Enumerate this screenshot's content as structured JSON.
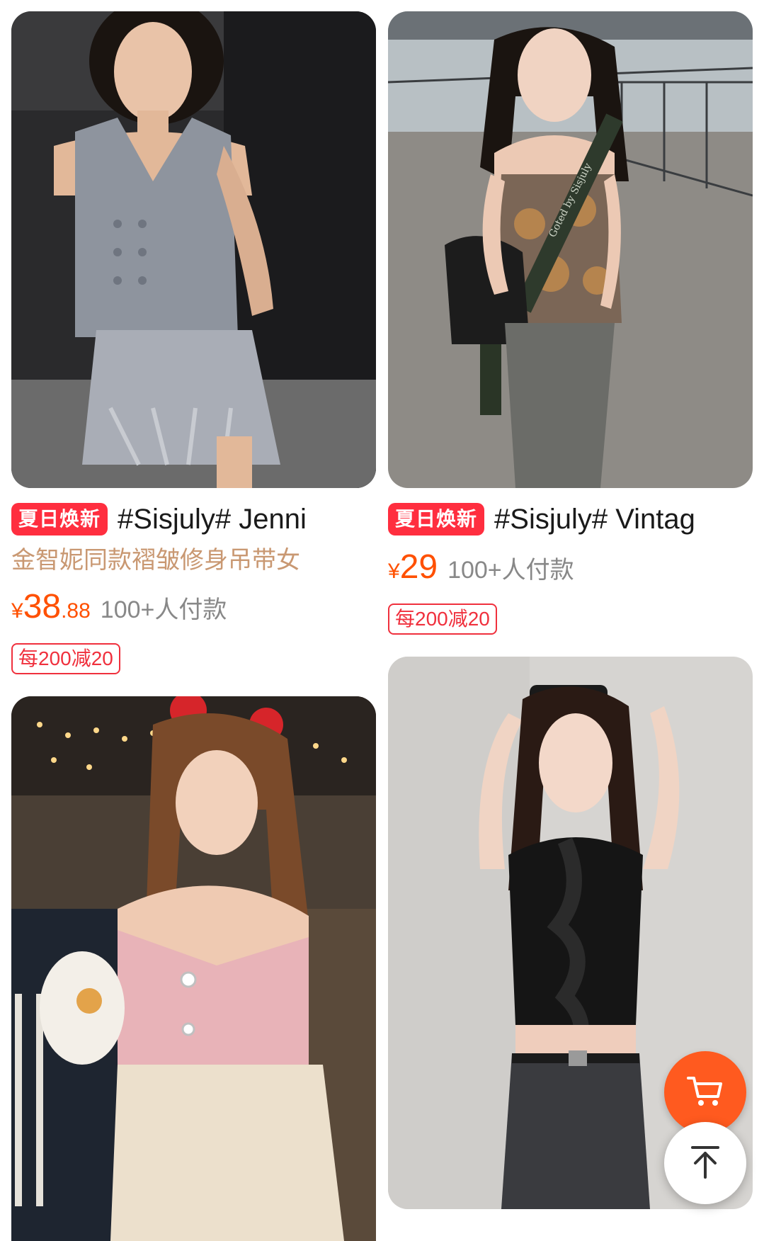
{
  "products": [
    {
      "tag": "夏日焕新",
      "title": "#Sisjuly# Jenni",
      "subtitle": "金智妮同款褶皱修身吊带女",
      "price_currency": "¥",
      "price_int": "38",
      "price_dec": ".88",
      "paid": "100+人付款",
      "coupon": "每200减20"
    },
    {
      "tag": "夏日焕新",
      "title": "#Sisjuly# Vintag",
      "price_currency": "¥",
      "price_int": "29",
      "paid": "100+人付款",
      "coupon": "每200减20"
    }
  ],
  "images": {
    "bag_strap_text": "Goted by Sisjuly"
  },
  "colors": {
    "tag": "#ff2e3f",
    "price": "#ff5000",
    "subtitle": "#c99872",
    "cart_button": "#ff5a1f"
  },
  "icons": {
    "cart": "shopping-cart-icon",
    "top": "back-to-top-icon"
  }
}
